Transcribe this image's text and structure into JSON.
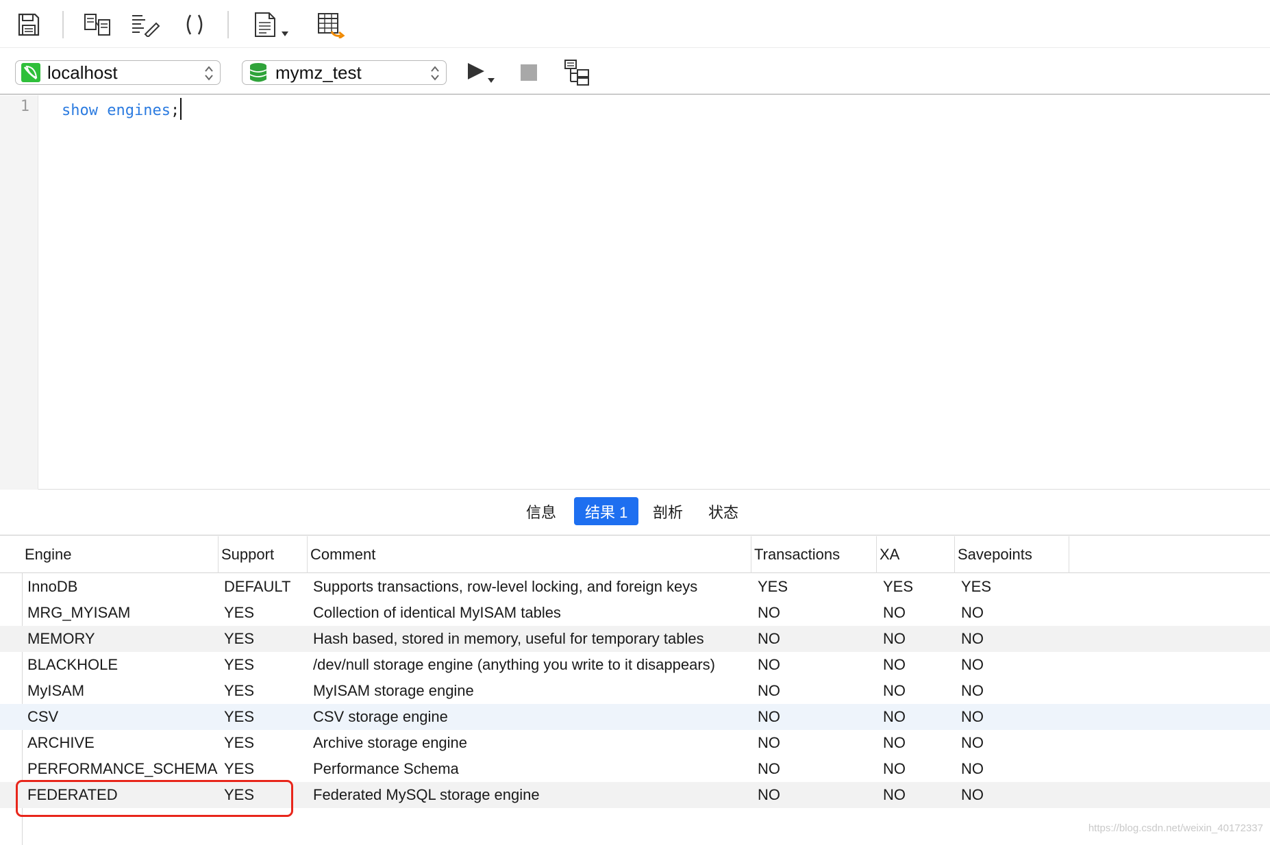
{
  "toolbar": {
    "icons": [
      "save-icon",
      "query-builder-icon",
      "beautify-sql-icon",
      "code-snippet-icon",
      "text-export-icon",
      "explain-table-icon"
    ]
  },
  "connection": {
    "host": "localhost",
    "database": "mymz_test",
    "icons": [
      "connection-leaf-icon",
      "database-icon",
      "run-icon",
      "stop-icon",
      "explain-icon"
    ]
  },
  "editor": {
    "line_number": "1",
    "keyword": "show",
    "identifier": "engines",
    "terminator": ";"
  },
  "tabs": [
    {
      "label": "信息",
      "active": false
    },
    {
      "label": "结果 1",
      "active": true
    },
    {
      "label": "剖析",
      "active": false
    },
    {
      "label": "状态",
      "active": false
    }
  ],
  "table": {
    "columns": [
      "Engine",
      "Support",
      "Comment",
      "Transactions",
      "XA",
      "Savepoints"
    ],
    "rows": [
      [
        "InnoDB",
        "DEFAULT",
        "Supports transactions, row-level locking, and foreign keys",
        "YES",
        "YES",
        "YES"
      ],
      [
        "MRG_MYISAM",
        "YES",
        "Collection of identical MyISAM tables",
        "NO",
        "NO",
        "NO"
      ],
      [
        "MEMORY",
        "YES",
        "Hash based, stored in memory, useful for temporary tables",
        "NO",
        "NO",
        "NO"
      ],
      [
        "BLACKHOLE",
        "YES",
        "/dev/null storage engine (anything you write to it disappears)",
        "NO",
        "NO",
        "NO"
      ],
      [
        "MyISAM",
        "YES",
        "MyISAM storage engine",
        "NO",
        "NO",
        "NO"
      ],
      [
        "CSV",
        "YES",
        "CSV storage engine",
        "NO",
        "NO",
        "NO"
      ],
      [
        "ARCHIVE",
        "YES",
        "Archive storage engine",
        "NO",
        "NO",
        "NO"
      ],
      [
        "PERFORMANCE_SCHEMA",
        "YES",
        "Performance Schema",
        "NO",
        "NO",
        "NO"
      ],
      [
        "FEDERATED",
        "YES",
        "Federated MySQL storage engine",
        "NO",
        "NO",
        "NO"
      ]
    ]
  },
  "highlight_color": "#e8261b",
  "accent_color": "#1e6ff0",
  "watermark": "https://blog.csdn.net/weixin_40172337"
}
